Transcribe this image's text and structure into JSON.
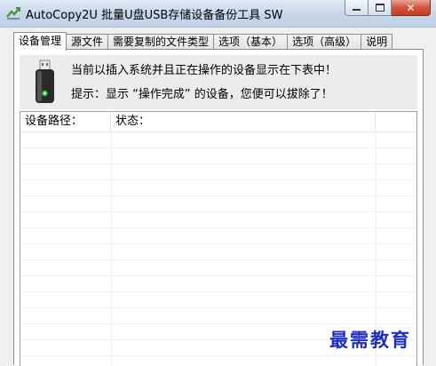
{
  "window": {
    "title": "AutoCopy2U 批量U盘USB存储设备备份工具 SW",
    "close_glyph": "✕"
  },
  "tabs": [
    {
      "label": "设备管理",
      "active": true
    },
    {
      "label": "源文件"
    },
    {
      "label": "需要复制的文件类型"
    },
    {
      "label": "选项（基本）"
    },
    {
      "label": "选项（高级）"
    },
    {
      "label": "说明"
    }
  ],
  "info": {
    "icon": "usb-drive-icon",
    "line1": "当前以插入系统并且正在操作的设备显示在下表中！",
    "line2": "提示：显示 “操作完成” 的设备，您便可以拔除了！"
  },
  "device_list": {
    "columns": [
      "设备路径：",
      "状态："
    ],
    "rows": []
  },
  "watermark": "最需教育",
  "colors": {
    "watermark": "#1f2fc2",
    "titlebar": "#c6d6ea",
    "close_button": "#c23e22"
  }
}
